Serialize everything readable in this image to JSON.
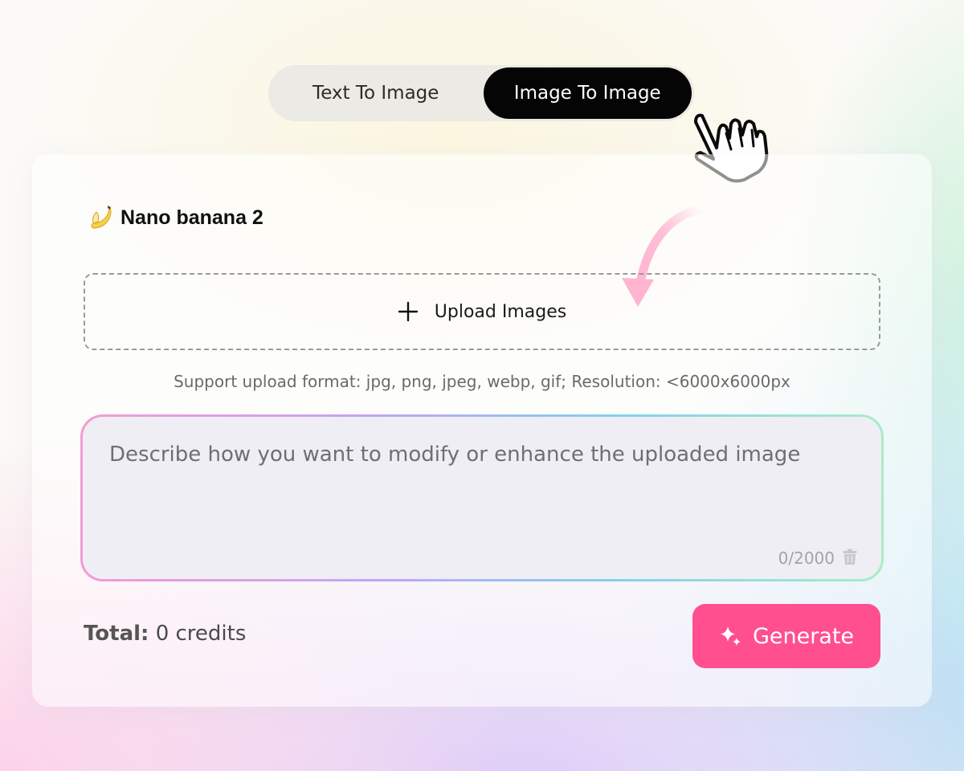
{
  "mode_toggle": {
    "tabs": [
      {
        "label": "Text To Image",
        "active": false
      },
      {
        "label": "Image To Image",
        "active": true
      }
    ]
  },
  "decorations": {
    "pointer_icon": "hand-pointer-icon",
    "arrow_icon": "curved-arrow-icon",
    "arrow_color": "#ff5a98"
  },
  "model": {
    "icon": "banana-icon",
    "name": "Nano banana 2"
  },
  "upload": {
    "icon": "plus-icon",
    "label": "Upload Images",
    "format_note": "Support upload format: jpg, png, jpeg, webp, gif; Resolution: <6000x6000px"
  },
  "prompt": {
    "value": "",
    "placeholder": "Describe how you want to modify or enhance the uploaded image",
    "counter": "0/2000",
    "clear_icon": "trash-icon"
  },
  "footer": {
    "total_label": "Total:",
    "total_value": "0 credits",
    "generate_label": "Generate",
    "generate_icon": "sparkle-icon"
  },
  "colors": {
    "accent": "#ff4f8f",
    "active_tab_bg": "#050505",
    "toggle_bg": "#ebeae4",
    "prompt_gradient": [
      "#f59bd3",
      "#c0a6f3",
      "#82d0ec",
      "#a9ecc6"
    ]
  }
}
